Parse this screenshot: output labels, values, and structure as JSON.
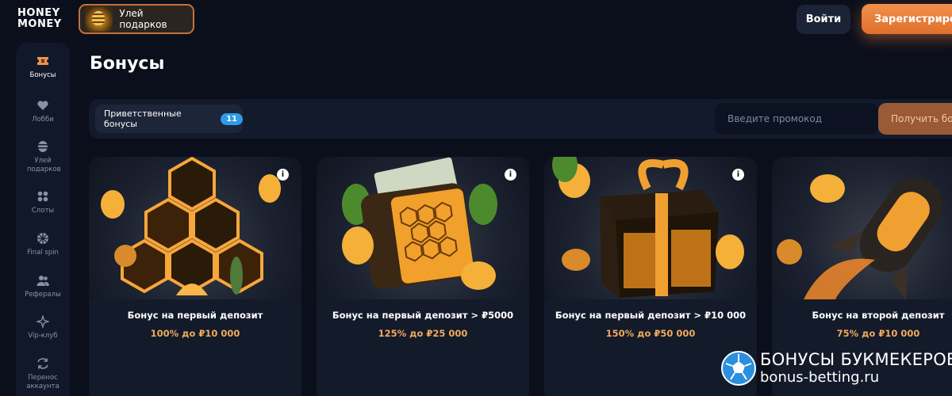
{
  "brand": {
    "logo_line1": "HONEY",
    "logo_line2": "MONEY"
  },
  "header": {
    "hive_label": "Улей подарков",
    "login": "Войти",
    "register": "Зарегистрирова"
  },
  "sidebar": {
    "items": [
      {
        "label": "Бонусы",
        "icon": "ticket-icon",
        "active": true
      },
      {
        "label": "Лобби",
        "icon": "heart-icon"
      },
      {
        "label": "Улей подарков",
        "icon": "hive-icon"
      },
      {
        "label": "Слоты",
        "icon": "grid-icon"
      },
      {
        "label": "Final spin",
        "icon": "wheel-icon"
      },
      {
        "label": "Рефералы",
        "icon": "users-icon"
      },
      {
        "label": "Vip-клуб",
        "icon": "sparkle-icon"
      },
      {
        "label": "Перенос аккаунта",
        "icon": "transfer-icon"
      }
    ]
  },
  "main": {
    "title": "Бонусы",
    "tabs": [
      {
        "label": "Приветственные бонусы",
        "count": "11"
      }
    ],
    "promo": {
      "placeholder": "Введите промокод",
      "button": "Получить бо"
    },
    "cards": [
      {
        "title": "Бонус на первый депозит",
        "subtitle": "100% до ₽10 000"
      },
      {
        "title": "Бонус на первый депозит > ₽5000",
        "subtitle": "125% до ₽25 000"
      },
      {
        "title": "Бонус на первый депозит > ₽10 000",
        "subtitle": "150% до ₽50 000"
      },
      {
        "title": "Бонус на второй депозит",
        "subtitle": "75% до ₽10 000"
      }
    ]
  },
  "watermark": {
    "line1": "БОНУСЫ БУКМЕКЕРОВ",
    "line2": "bonus-betting.ru"
  },
  "colors": {
    "accent": "#f0904a",
    "badge": "#2f9be8",
    "bg": "#0b0f1b",
    "panel": "#121a2c"
  }
}
